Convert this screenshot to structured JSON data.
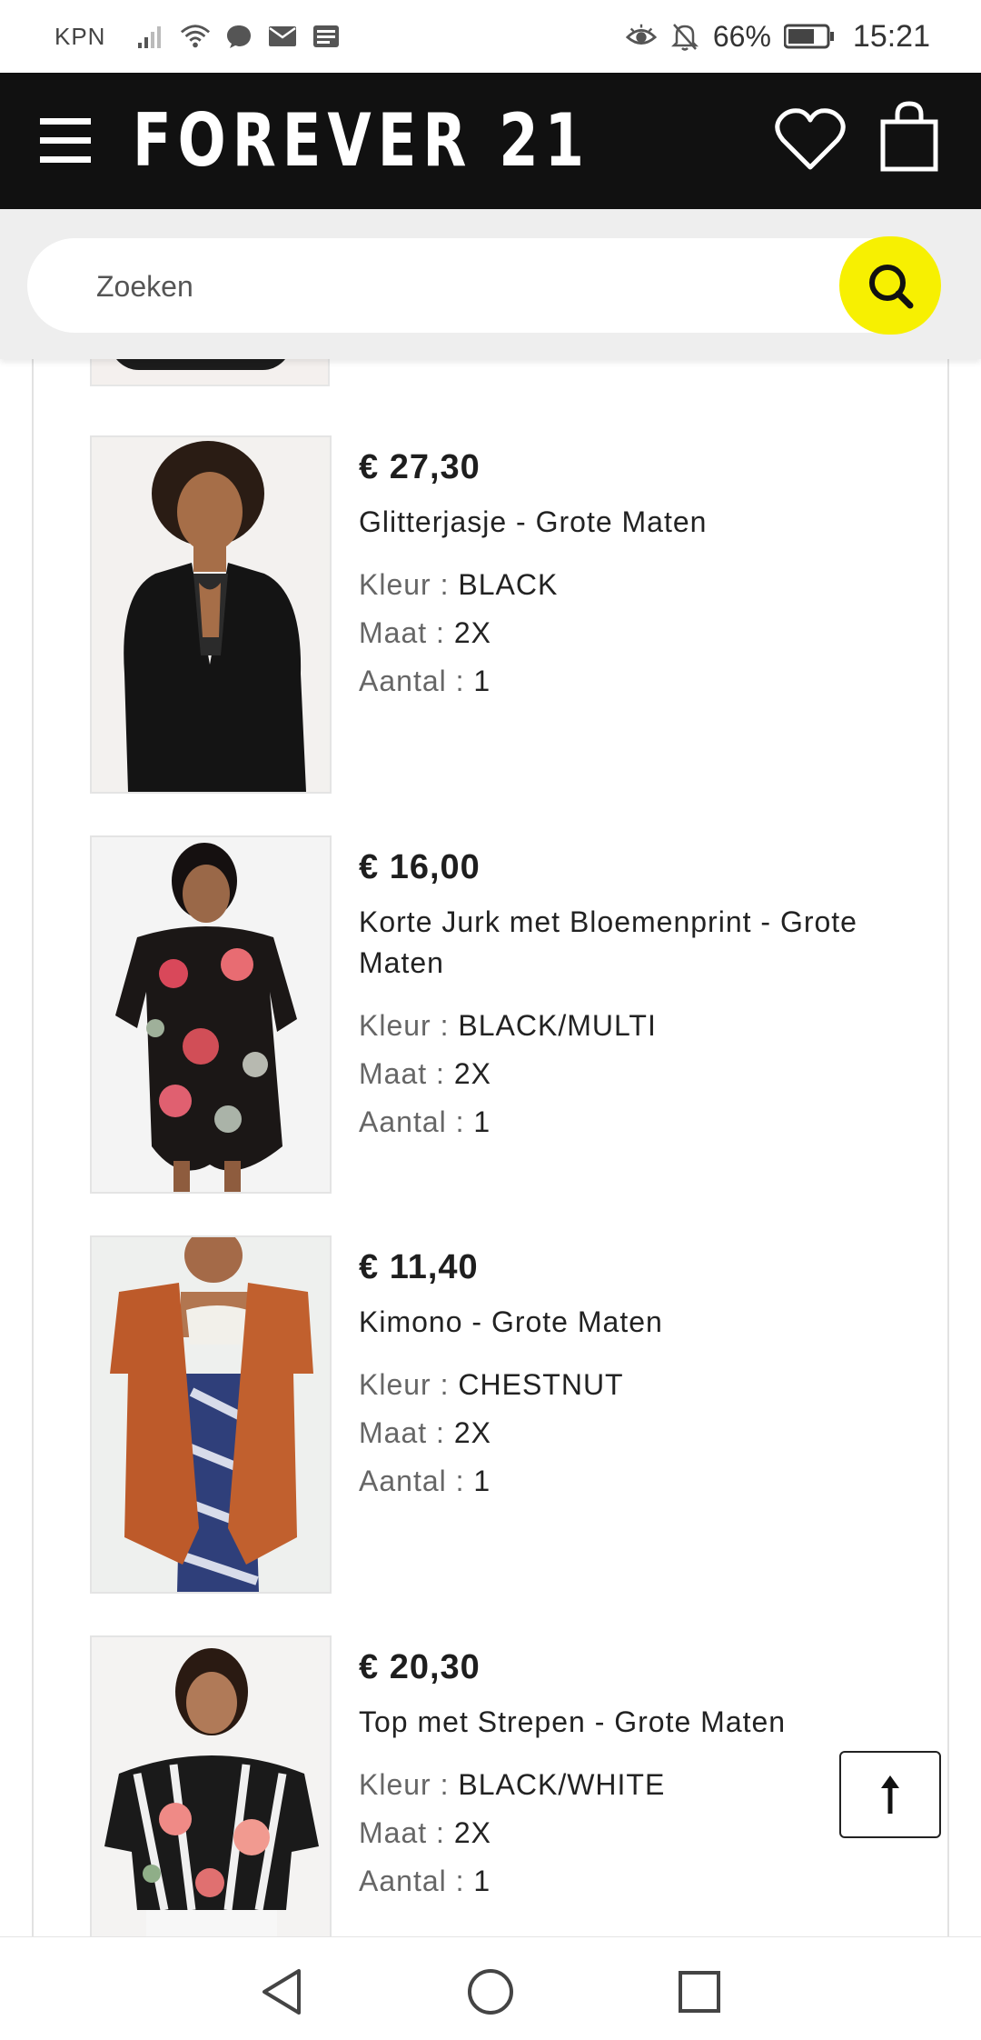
{
  "status_bar": {
    "carrier": "KPN",
    "battery": "66%",
    "time": "15:21"
  },
  "header": {
    "brand": "FOREVER 21"
  },
  "search": {
    "placeholder": "Zoeken"
  },
  "products": [
    {
      "price": "€ 27,30",
      "name": "Glitterjasje - Grote Maten",
      "color_label": "Kleur : ",
      "color": "BLACK",
      "size_label": "Maat : ",
      "size": "2X",
      "qty_label": "Aantal : ",
      "qty": "1"
    },
    {
      "price": "€ 16,00",
      "name": "Korte Jurk met Bloemenprint - Grote Maten",
      "color_label": "Kleur : ",
      "color": "BLACK/MULTI",
      "size_label": "Maat : ",
      "size": "2X",
      "qty_label": "Aantal : ",
      "qty": "1"
    },
    {
      "price": "€ 11,40",
      "name": "Kimono - Grote Maten",
      "color_label": "Kleur : ",
      "color": "CHESTNUT",
      "size_label": "Maat : ",
      "size": "2X",
      "qty_label": "Aantal : ",
      "qty": "1"
    },
    {
      "price": "€ 20,30",
      "name": "Top met Strepen - Grote Maten",
      "color_label": "Kleur : ",
      "color": "BLACK/WHITE",
      "size_label": "Maat : ",
      "size": "2X",
      "qty_label": "Aantal : ",
      "qty": "1"
    }
  ],
  "colors": {
    "header_bg": "#111111",
    "search_button": "#f7f001",
    "search_bg": "#eeeeee"
  },
  "icons": {
    "menu": "hamburger-icon",
    "wishlist": "heart-icon",
    "bag": "shopping-bag-icon",
    "search": "search-icon",
    "back_to_top": "arrow-up-icon",
    "nav_back": "triangle-back-icon",
    "nav_home": "circle-home-icon",
    "nav_recent": "square-recent-icon"
  }
}
